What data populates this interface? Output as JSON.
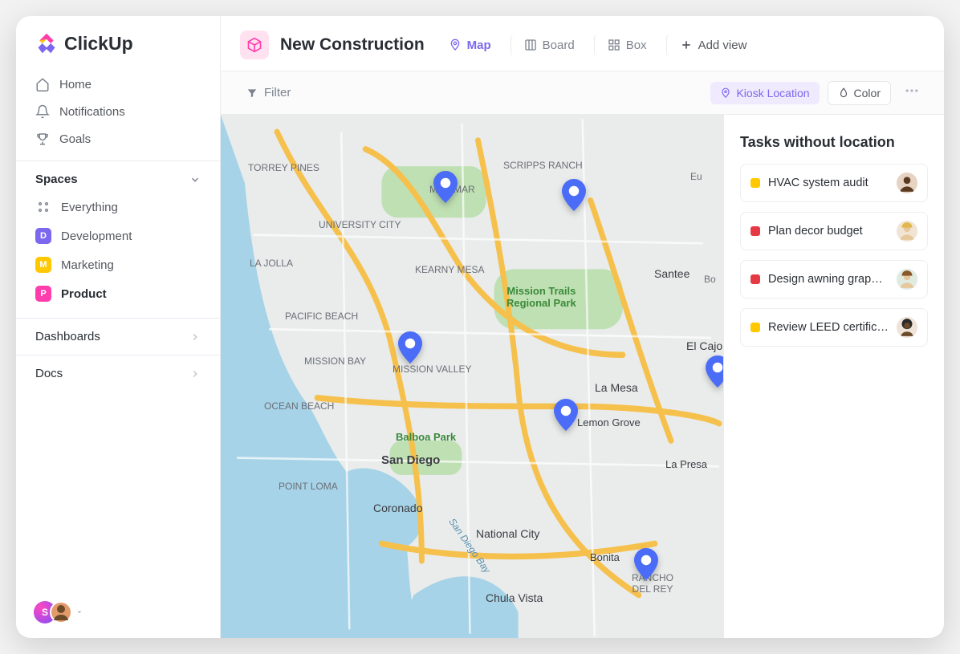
{
  "brand": "ClickUp",
  "nav": {
    "home": "Home",
    "notifications": "Notifications",
    "goals": "Goals"
  },
  "spaces": {
    "header": "Spaces",
    "everything": "Everything",
    "items": [
      {
        "initial": "D",
        "label": "Development",
        "color": "#7b68ee"
      },
      {
        "initial": "M",
        "label": "Marketing",
        "color": "#ffc800"
      },
      {
        "initial": "P",
        "label": "Product",
        "color": "#ff3dad"
      }
    ]
  },
  "sections": {
    "dashboards": "Dashboards",
    "docs": "Docs"
  },
  "user": {
    "initial": "S"
  },
  "project": {
    "title": "New Construction",
    "views": {
      "map": "Map",
      "board": "Board",
      "box": "Box",
      "add": "Add view"
    }
  },
  "filterbar": {
    "filter": "Filter",
    "kiosk": "Kiosk Location",
    "color": "Color"
  },
  "map": {
    "labels": {
      "torrey_pines": "TORREY PINES",
      "miramar": "MIRAMAR",
      "scripps_ranch": "SCRIPPS RANCH",
      "university_city": "UNIVERSITY CITY",
      "la_jolla": "LA JOLLA",
      "kearny_mesa": "KEARNY MESA",
      "pacific_beach": "PACIFIC BEACH",
      "mission_bay": "MISSION BAY",
      "mission_valley": "MISSION VALLEY",
      "ocean_beach": "OCEAN BEACH",
      "balboa_park": "Balboa Park",
      "san_diego": "San Diego",
      "point_loma": "POINT LOMA",
      "coronado": "Coronado",
      "national_city": "National City",
      "chula_vista": "Chula Vista",
      "santee": "Santee",
      "la_mesa": "La Mesa",
      "el_cajo": "El Cajo",
      "lemon_grove": "Lemon Grove",
      "la_presa": "La Presa",
      "bonita": "Bonita",
      "rancho_del_rey": "RANCHO\nDEL REY",
      "mission_trails": "Mission Trails\nRegional Park",
      "san_diego_bay": "San Diego Bay",
      "eu": "Eu",
      "bo": "Bo"
    }
  },
  "side_panel": {
    "title": "Tasks without location",
    "tasks": [
      {
        "status": "#ffc800",
        "title": "HVAC system audit"
      },
      {
        "status": "#e63946",
        "title": "Plan decor budget"
      },
      {
        "status": "#e63946",
        "title": "Design awning grap…"
      },
      {
        "status": "#ffc800",
        "title": "Review LEED certific…"
      }
    ]
  }
}
